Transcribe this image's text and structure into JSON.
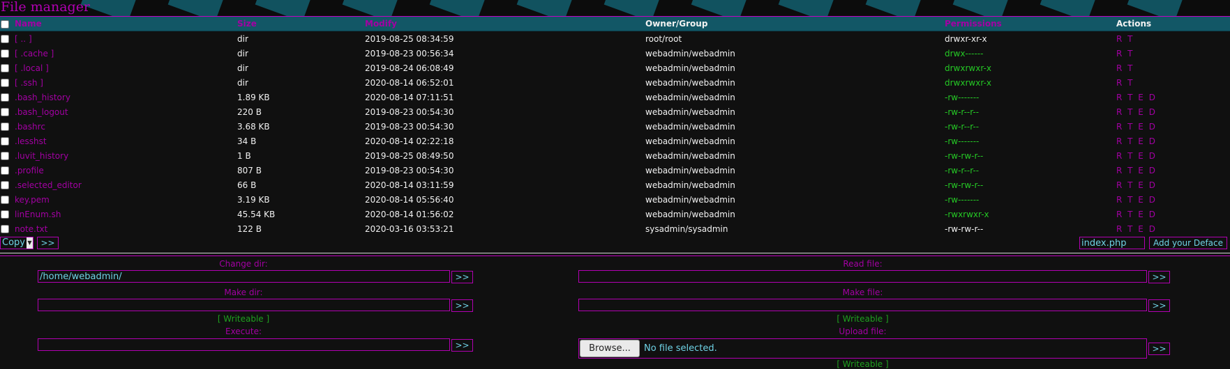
{
  "title": "File manager",
  "columns": {
    "name": "Name",
    "size": "Size",
    "modify": "Modify",
    "owner": "Owner/Group",
    "permissions": "Permissions",
    "actions": "Actions"
  },
  "rows": [
    {
      "name": "[ .. ]",
      "size": "dir",
      "modify": "2019-08-25 08:34:59",
      "owner": "root/root",
      "perms": "drwxr-xr-x",
      "actions": "R T",
      "perm_color": "white"
    },
    {
      "name": "[ .cache ]",
      "size": "dir",
      "modify": "2019-08-23 00:56:34",
      "owner": "webadmin/webadmin",
      "perms": "drwx------",
      "actions": "R T",
      "perm_color": "green"
    },
    {
      "name": "[ .local ]",
      "size": "dir",
      "modify": "2019-08-24 06:08:49",
      "owner": "webadmin/webadmin",
      "perms": "drwxrwxr-x",
      "actions": "R T",
      "perm_color": "green"
    },
    {
      "name": "[ .ssh ]",
      "size": "dir",
      "modify": "2020-08-14 06:52:01",
      "owner": "webadmin/webadmin",
      "perms": "drwxrwxr-x",
      "actions": "R T",
      "perm_color": "green"
    },
    {
      "name": ".bash_history",
      "size": "1.89 KB",
      "modify": "2020-08-14 07:11:51",
      "owner": "webadmin/webadmin",
      "perms": "-rw-------",
      "actions": "R T E D",
      "perm_color": "green"
    },
    {
      "name": ".bash_logout",
      "size": "220 B",
      "modify": "2019-08-23 00:54:30",
      "owner": "webadmin/webadmin",
      "perms": "-rw-r--r--",
      "actions": "R T E D",
      "perm_color": "green"
    },
    {
      "name": ".bashrc",
      "size": "3.68 KB",
      "modify": "2019-08-23 00:54:30",
      "owner": "webadmin/webadmin",
      "perms": "-rw-r--r--",
      "actions": "R T E D",
      "perm_color": "green"
    },
    {
      "name": ".lesshst",
      "size": "34 B",
      "modify": "2020-08-14 02:22:18",
      "owner": "webadmin/webadmin",
      "perms": "-rw-------",
      "actions": "R T E D",
      "perm_color": "green"
    },
    {
      "name": ".luvit_history",
      "size": "1 B",
      "modify": "2019-08-25 08:49:50",
      "owner": "webadmin/webadmin",
      "perms": "-rw-rw-r--",
      "actions": "R T E D",
      "perm_color": "green"
    },
    {
      "name": ".profile",
      "size": "807 B",
      "modify": "2019-08-23 00:54:30",
      "owner": "webadmin/webadmin",
      "perms": "-rw-r--r--",
      "actions": "R T E D",
      "perm_color": "green"
    },
    {
      "name": ".selected_editor",
      "size": "66 B",
      "modify": "2020-08-14 03:11:59",
      "owner": "webadmin/webadmin",
      "perms": "-rw-rw-r--",
      "actions": "R T E D",
      "perm_color": "green"
    },
    {
      "name": "key.pem",
      "size": "3.19 KB",
      "modify": "2020-08-14 05:56:40",
      "owner": "webadmin/webadmin",
      "perms": "-rw-------",
      "actions": "R T E D",
      "perm_color": "green"
    },
    {
      "name": "linEnum.sh",
      "size": "45.54 KB",
      "modify": "2020-08-14 01:56:02",
      "owner": "webadmin/webadmin",
      "perms": "-rwxrwxr-x",
      "actions": "R T E D",
      "perm_color": "green"
    },
    {
      "name": "note.txt",
      "size": "122 B",
      "modify": "2020-03-16 03:53:21",
      "owner": "sysadmin/sysadmin",
      "perms": "-rw-rw-r--",
      "actions": "R T E D",
      "perm_color": "white"
    }
  ],
  "toolbar": {
    "action_select": "Copy",
    "go_label": ">>",
    "deface_value": "index.php",
    "deface_button": "Add your Deface"
  },
  "panel": {
    "change_dir_label": "Change dir:",
    "change_dir_value": "/home/webadmin/",
    "read_file_label": "Read file:",
    "read_file_value": "",
    "make_dir_label": "Make dir:",
    "make_dir_value": "",
    "make_file_label": "Make file:",
    "make_file_value": "",
    "writeable": "[ Writeable ]",
    "execute_label": "Execute:",
    "execute_value": "",
    "upload_label": "Upload file:",
    "browse_label": "Browse...",
    "no_file": "No file selected.",
    "go_label": ">>"
  },
  "colors": {
    "magenta": "#a300a3",
    "header_teal": "#125766",
    "green": "#25c925",
    "input_text": "#6fd3e6"
  }
}
